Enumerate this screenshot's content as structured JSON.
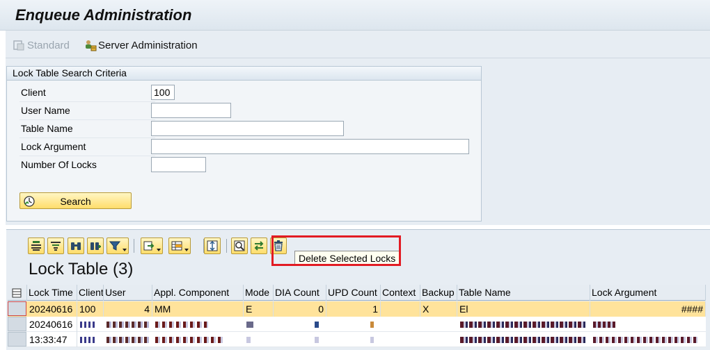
{
  "window": {
    "title": "Enqueue Administration"
  },
  "toolbar": {
    "standard_label": "Standard",
    "server_admin_label": "Server Administration"
  },
  "criteria": {
    "title": "Lock Table Search Criteria",
    "fields": {
      "client": {
        "label": "Client",
        "value": "100"
      },
      "user_name": {
        "label": "User Name",
        "value": ""
      },
      "table_name": {
        "label": "Table Name",
        "value": ""
      },
      "lock_argument": {
        "label": "Lock Argument",
        "value": ""
      },
      "number_of_locks": {
        "label": "Number Of Locks",
        "value": ""
      }
    },
    "search_label": "Search"
  },
  "alv": {
    "tooltip": "Delete Selected Locks",
    "icons": [
      "details-icon",
      "select-layout-icon",
      "find-icon",
      "find-next-icon",
      "filter-icon",
      "export-icon",
      "layout-icon",
      "optimize-width-icon",
      "refresh-icon",
      "transfer-icon",
      "delete-icon"
    ]
  },
  "table": {
    "title": "Lock Table (3)",
    "columns": [
      "Lock Time",
      "Client",
      "User",
      "Appl. Component",
      "Mode",
      "DIA Count",
      "UPD Count",
      "Context",
      "Backup",
      "Table Name",
      "Lock Argument"
    ],
    "rows": [
      {
        "lock_time": "20240616",
        "client": "100",
        "user": "4",
        "appl_component": "MM",
        "mode": "E",
        "dia_count": "0",
        "upd_count": "1",
        "context": "",
        "backup": "X",
        "table_name": "El",
        "lock_argument": "####"
      },
      {
        "lock_time": "20240616",
        "client": "",
        "user": "",
        "appl_component": "",
        "mode": "",
        "dia_count": "",
        "upd_count": "",
        "context": "",
        "backup": "",
        "table_name": "",
        "lock_argument": ""
      },
      {
        "lock_time": "13:33:47",
        "client": "",
        "user": "",
        "appl_component": "",
        "mode": "",
        "dia_count": "",
        "upd_count": "",
        "context": "",
        "backup": "",
        "table_name": "",
        "lock_argument": ""
      }
    ]
  },
  "colors": {
    "highlight_row": "#ffe39b",
    "button_yellow": "#ffdd6b",
    "annotation_red": "#e21b23"
  }
}
